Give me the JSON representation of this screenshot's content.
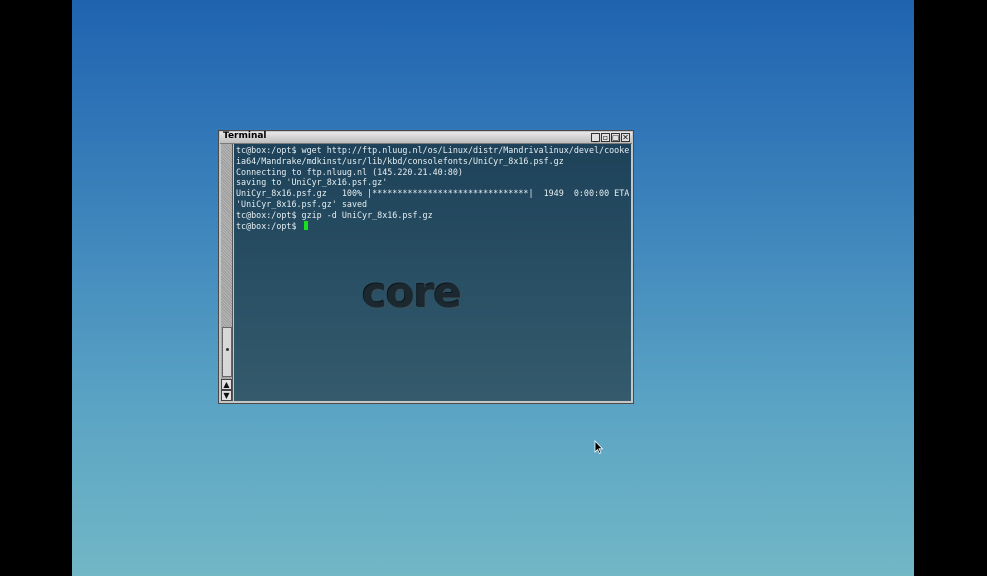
{
  "window": {
    "title": "Terminal",
    "buttons": {
      "minimize": "_",
      "restore": "▫",
      "maximize": "▢",
      "close": "✕"
    }
  },
  "scrollbar": {
    "up": "▲",
    "down": "▼"
  },
  "terminal": {
    "lines": [
      "tc@box:/opt$ wget http://ftp.nluug.nl/os/Linux/distr/Mandrivalinux/devel/cooker/",
      "ia64/Mandrake/mdkinst/usr/lib/kbd/consolefonts/UniCyr_8x16.psf.gz",
      "Connecting to ftp.nluug.nl (145.220.21.40:80)",
      "saving to 'UniCyr_8x16.psf.gz'",
      "UniCyr_8x16.psf.gz   100% |*******************************|  1949  0:00:00 ETA",
      "'UniCyr_8x16.psf.gz' saved",
      "tc@box:/opt$ gzip -d UniCyr_8x16.psf.gz"
    ],
    "prompt": "tc@box:/opt$ ",
    "cursor_color": "#19e01d"
  },
  "logo": {
    "text": "core"
  }
}
